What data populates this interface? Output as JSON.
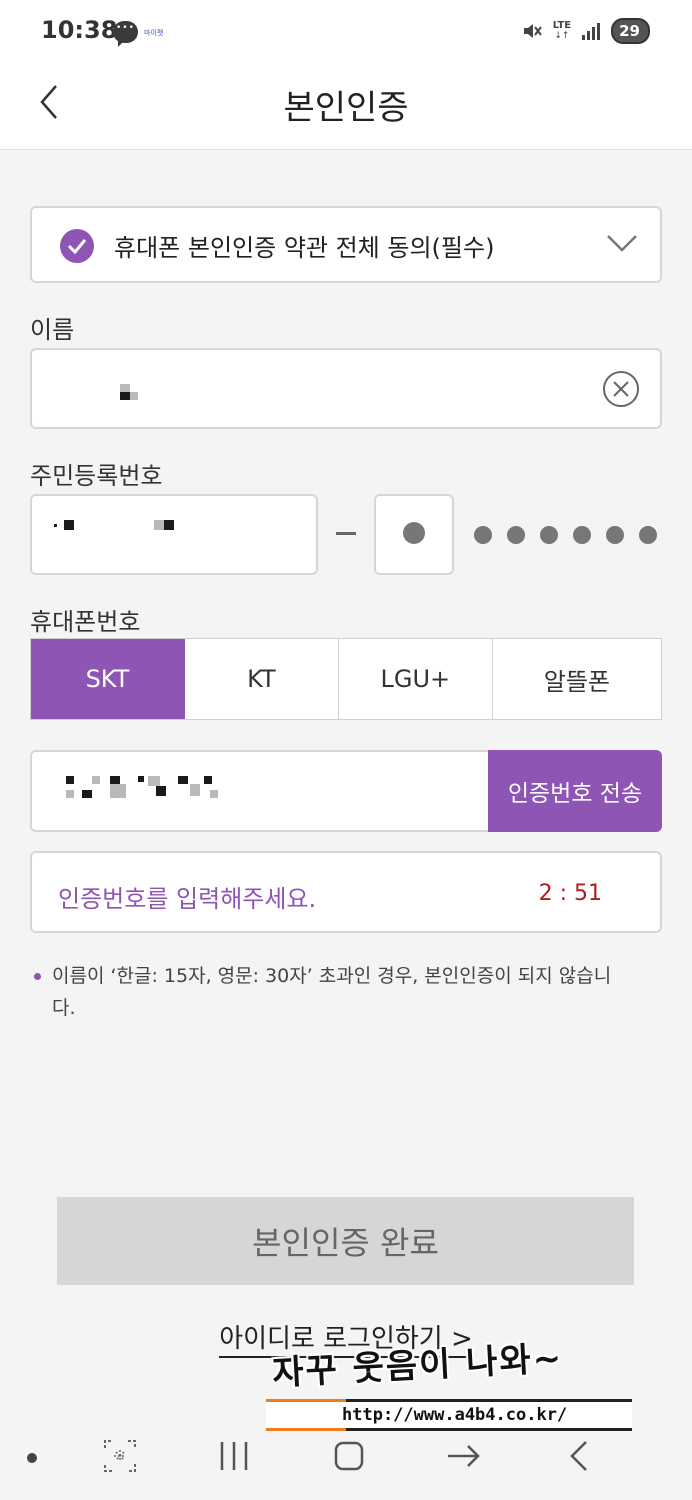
{
  "status_bar": {
    "time": "10:38",
    "mini_label": "마이펫",
    "network": "LTE",
    "battery": "29"
  },
  "header": {
    "title": "본인인증"
  },
  "agreement": {
    "label": "휴대폰 본인인증 약관 전체 동의(필수)",
    "checked": true
  },
  "form": {
    "name_label": "이름",
    "rrn_label": "주민등록번호",
    "phone_label": "휴대폰번호",
    "carriers": [
      {
        "label": "SKT",
        "selected": true
      },
      {
        "label": "KT",
        "selected": false
      },
      {
        "label": "LGU+",
        "selected": false
      },
      {
        "label": "알뜰폰",
        "selected": false
      }
    ],
    "send_code_button": "인증번호 전송",
    "code_placeholder": "인증번호를 입력해주세요.",
    "timer": "2 : 51"
  },
  "notice": {
    "text": "이름이 ‘한글: 15자, 영문: 30자’ 초과인 경우, 본인인증이 되지 않습니다."
  },
  "complete_button": "본인인증 완료",
  "login_link": "아이디로 로그인하기 >",
  "watermark": {
    "text": "자꾸 웃음이 나와~",
    "url": "http://www.a4b4.co.kr/"
  },
  "colors": {
    "accent": "#8e55b5",
    "timer": "#b01c1c",
    "disabled_button": "#d6d6d6"
  }
}
